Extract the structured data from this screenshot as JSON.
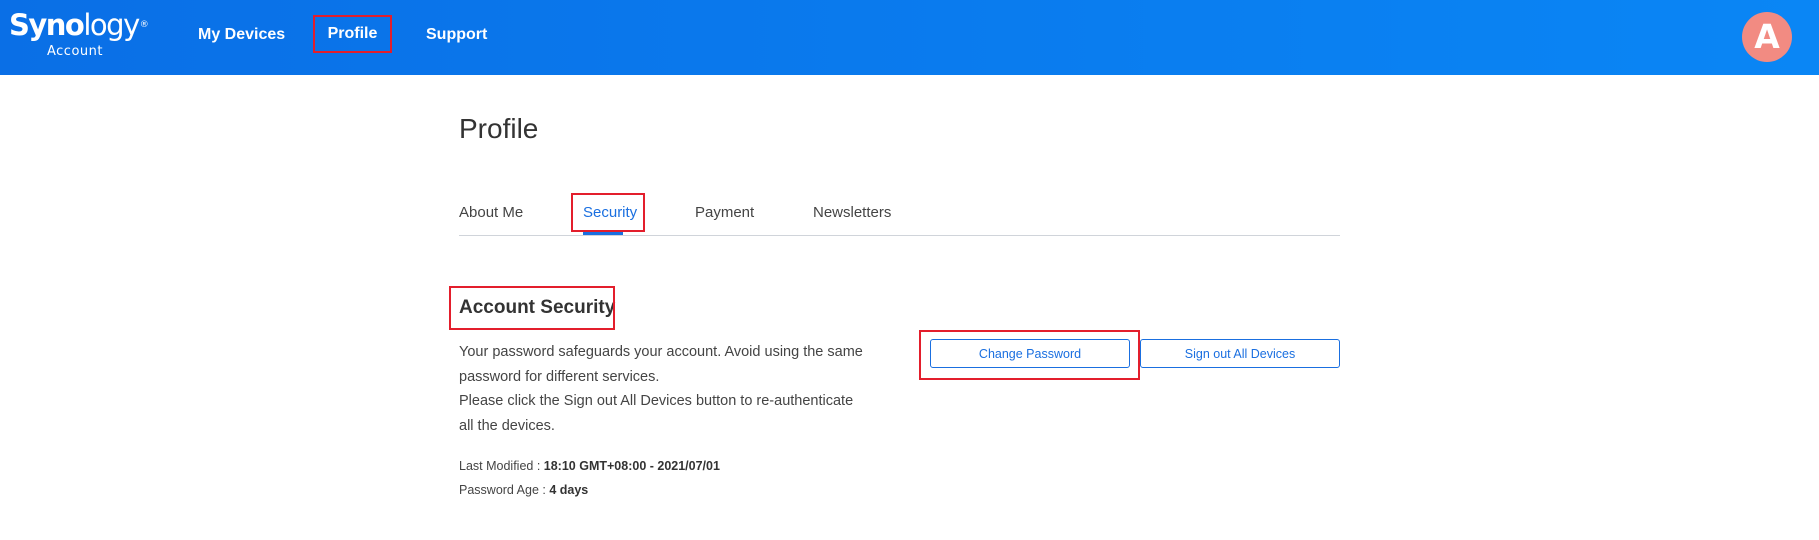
{
  "header": {
    "logo_text_bold": "Syno",
    "logo_text_light": "logy",
    "logo_registered": "®",
    "logo_sub": "Account",
    "nav": {
      "my_devices": "My Devices",
      "profile": "Profile",
      "support": "Support"
    },
    "avatar_letter": "A",
    "brand_color": "#0a7cf0",
    "avatar_color": "#f28b82"
  },
  "page": {
    "title": "Profile",
    "tabs": {
      "about_me": "About Me",
      "security": "Security",
      "payment": "Payment",
      "newsletters": "Newsletters"
    },
    "active_tab": "Security",
    "accent_color": "#1a6fe0"
  },
  "security": {
    "title": "Account Security",
    "desc_line1": "Your password safeguards your account. Avoid using the same",
    "desc_line2": "password for different services.",
    "desc_line3": "Please click the Sign out All Devices button to re-authenticate",
    "desc_line4": "all the devices.",
    "last_modified_label": "Last Modified :",
    "last_modified_value": "18:10 GMT+08:00 - 2021/07/01",
    "password_age_label": "Password Age :",
    "password_age_value": "4 days",
    "change_password_button": "Change Password",
    "sign_out_button": "Sign out All Devices"
  },
  "highlight_color": "#e31e2c"
}
